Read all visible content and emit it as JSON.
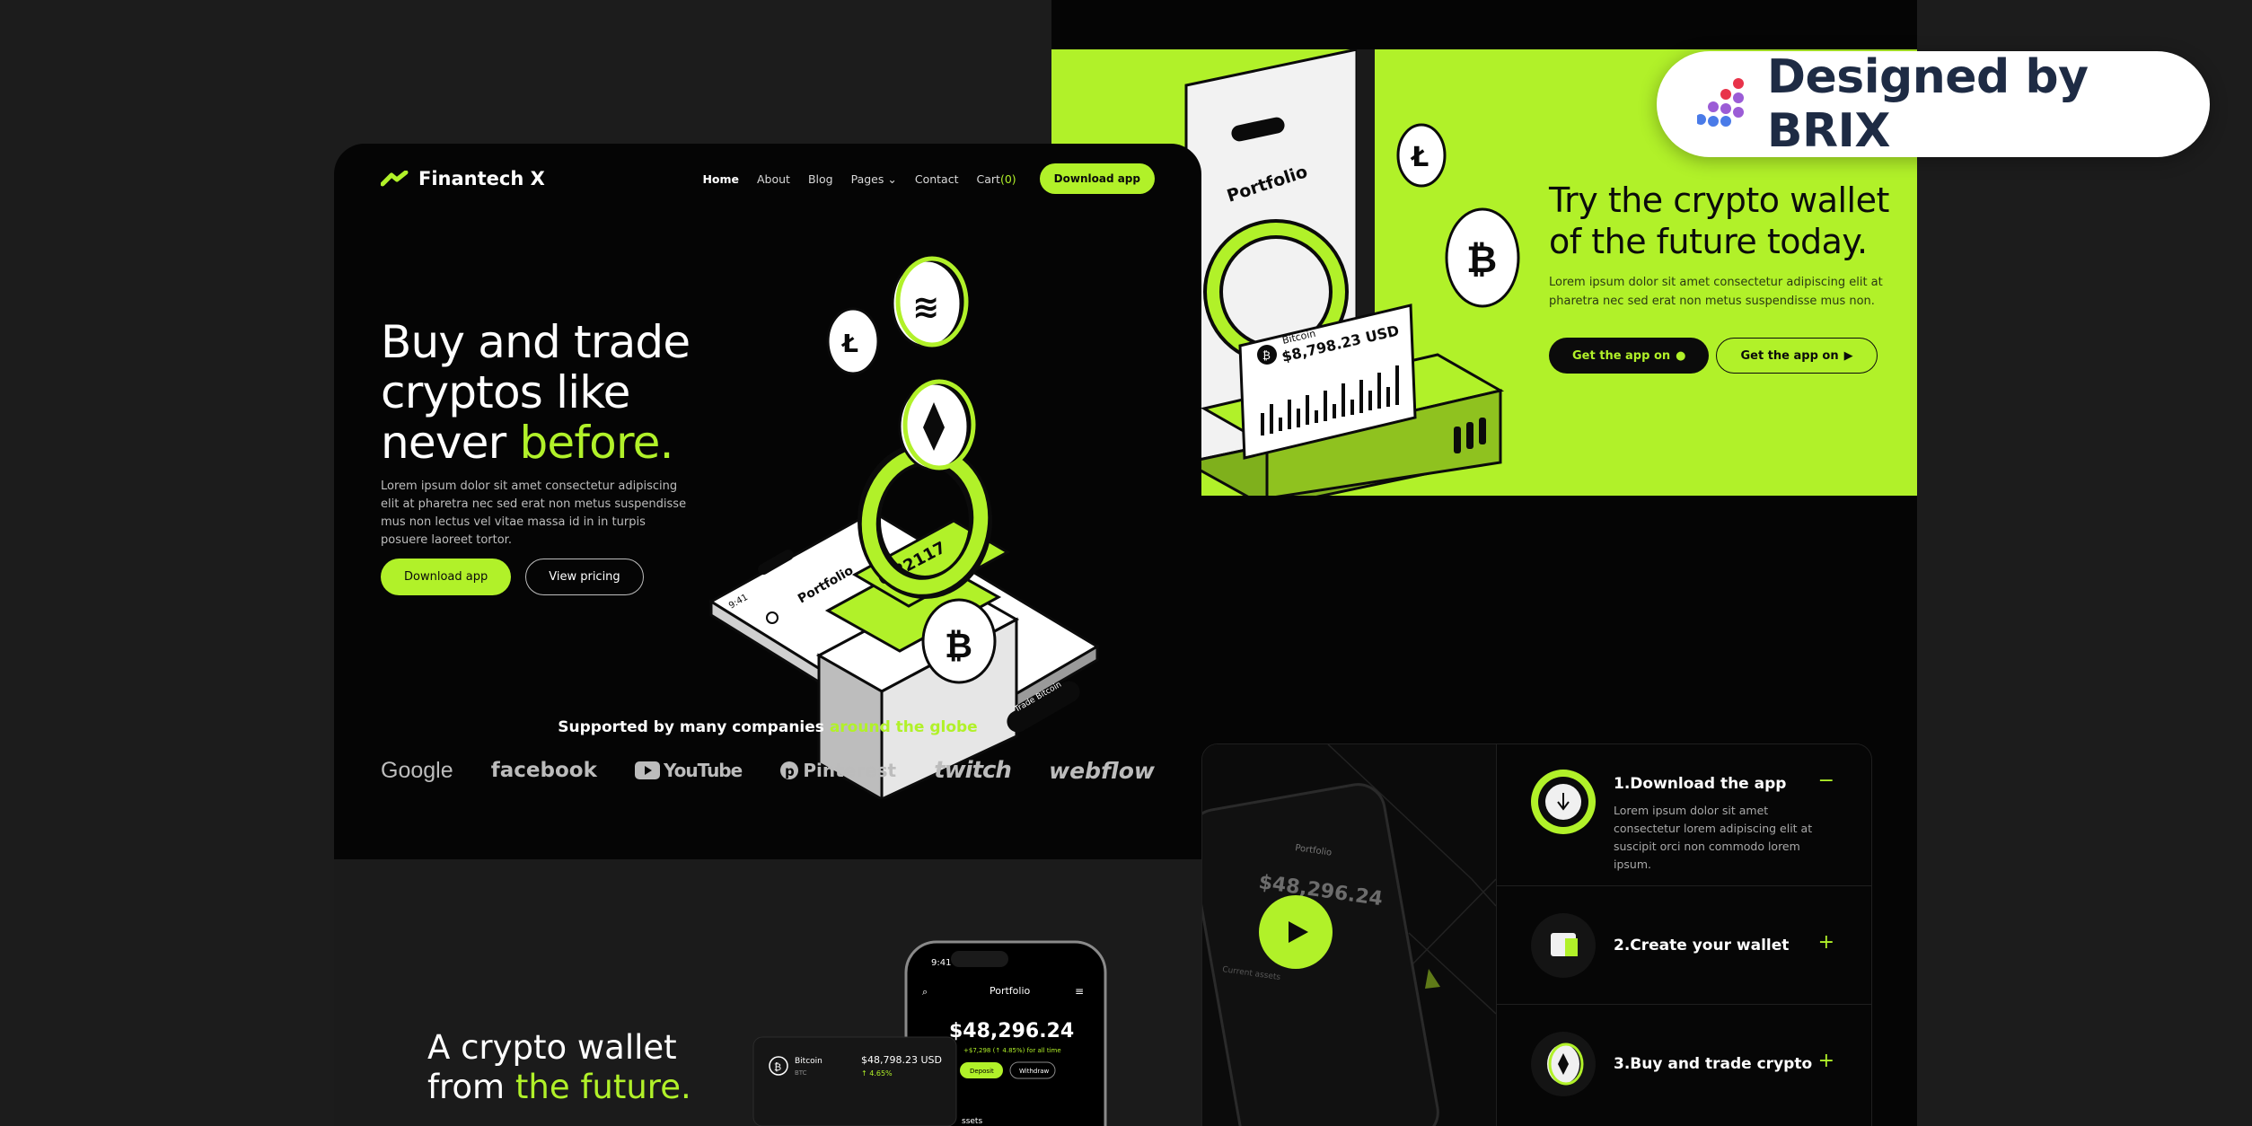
{
  "brand": {
    "name": "Finantech X"
  },
  "nav": {
    "items": [
      "Home",
      "About",
      "Blog",
      "Pages",
      "Contact"
    ],
    "cart_label": "Cart",
    "cart_count": "(0)",
    "download": "Download app"
  },
  "hero": {
    "title_line1": "Buy and trade",
    "title_line2": "cryptos like",
    "title_line3_pre": "never ",
    "title_line3_hl": "before.",
    "desc": "Lorem ipsum dolor sit amet consectetur adipiscing elit at pharetra nec sed erat non metus suspendisse mus non lectus vel vitae massa id in in turpis posuere laoreet tortor.",
    "btn_primary": "Download app",
    "btn_secondary": "View pricing"
  },
  "hero_art": {
    "phone_time": "9:41",
    "phone_title": "Portfolio",
    "amount": "0.22117",
    "trade_button": "Trade Bitcoin"
  },
  "supported": {
    "text": "Supported by many companies ",
    "hl": "around the globe"
  },
  "partners": [
    "Google",
    "facebook",
    "YouTube",
    "Pinterest",
    "twitch",
    "webflow"
  ],
  "wallet_section": {
    "title_line1": "A crypto wallet",
    "title_line2_pre": "from ",
    "title_line2_hl": "the future.",
    "phone_time": "9:41",
    "phone_title": "Portfolio",
    "balance": "$48,296.24",
    "change_line": "+$7,298 (↑ 4.85%) for all time",
    "deposit": "Deposit",
    "withdraw": "Withdraw",
    "assets": "ssets",
    "coin_name": "Bitcoin",
    "coin_ticker": "BTC",
    "coin_value": "$48,798.23 USD",
    "coin_change": "↑ 4.65%"
  },
  "cta": {
    "title_line1": "Try the crypto wallet",
    "title_line2": "of the future today.",
    "desc": "Lorem ipsum dolor sit amet consectetur adipiscing elit at pharetra nec sed erat non metus suspendisse mus non.",
    "btn_apple": "Get the app on",
    "btn_play": "Get the app on",
    "phone_title": "Portfolio",
    "card_coin": "Bitcoin",
    "card_value": "$8,798.23 USD"
  },
  "badge": {
    "text": "Designed by BRIX"
  },
  "video_phone": {
    "title": "Portfolio",
    "balance": "$48,296.24",
    "assets": "Current assets"
  },
  "steps": [
    {
      "title": "1.Download the app",
      "desc": "Lorem ipsum dolor sit amet consectetur lorem adipiscing elit at suscipit orci non commodo lorem ipsum.",
      "toggle": "−"
    },
    {
      "title": "2.Create your wallet",
      "toggle": "+"
    },
    {
      "title": "3.Buy and trade crypto",
      "toggle": "+"
    }
  ],
  "colors": {
    "accent": "#b1f129",
    "background": "#1c1c1c",
    "panel": "#050505"
  }
}
